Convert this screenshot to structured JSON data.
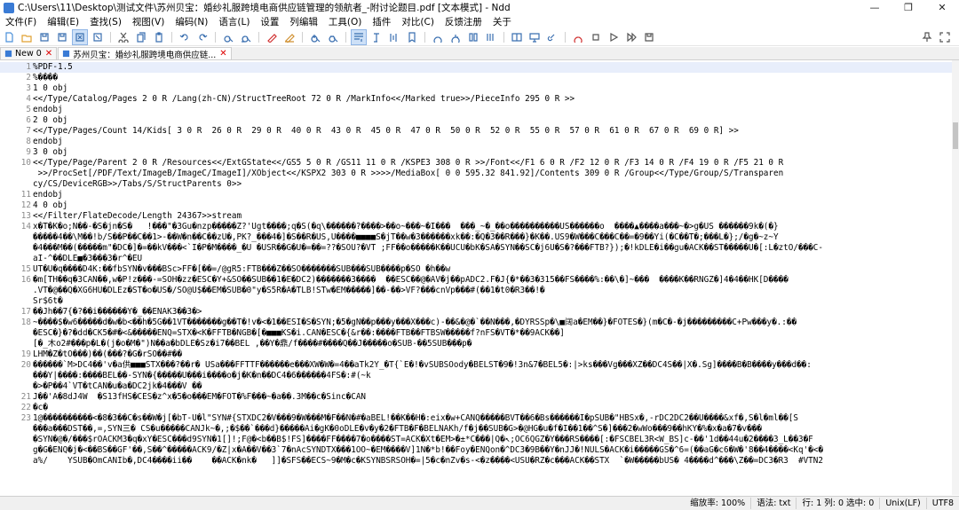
{
  "window": {
    "title": "C:\\Users\\11\\Desktop\\测试文件\\苏州贝宝：婚纱礼服跨境电商供应链管理的领航者_-附讨论题目.pdf [文本模式] - Ndd",
    "minimize_glyph": "—",
    "maximize_glyph": "❐",
    "close_glyph": "✕"
  },
  "menu": {
    "items": [
      {
        "label": "文件(F)"
      },
      {
        "label": "编辑(E)"
      },
      {
        "label": "查找(S)"
      },
      {
        "label": "视图(V)"
      },
      {
        "label": "编码(N)"
      },
      {
        "label": "语言(L)"
      },
      {
        "label": "设置"
      },
      {
        "label": "列编辑"
      },
      {
        "label": "工具(O)"
      },
      {
        "label": "插件"
      },
      {
        "label": "对比(C)"
      },
      {
        "label": "反馈注册"
      },
      {
        "label": "关于"
      }
    ]
  },
  "toolbar": {
    "icons": [
      {
        "name": "new-file-icon",
        "color": "#4a90d9"
      },
      {
        "name": "open-file-icon",
        "color": "#e0a030"
      },
      {
        "name": "save-icon",
        "color": "#3a6fb0"
      },
      {
        "name": "save-all-icon",
        "color": "#3a6fb0"
      },
      {
        "name": "close-file-icon",
        "color": "#3a6fb0"
      },
      {
        "name": "close-all-icon",
        "color": "#3a6fb0"
      },
      {
        "name": "cut-icon",
        "color": "#555555"
      },
      {
        "name": "copy-icon",
        "color": "#3a6fb0"
      },
      {
        "name": "paste-icon",
        "color": "#3a6fb0"
      },
      {
        "name": "undo-icon",
        "color": "#3a6fb0"
      },
      {
        "name": "redo-icon",
        "color": "#3a6fb0"
      },
      {
        "name": "find-icon",
        "color": "#3a6fb0"
      },
      {
        "name": "replace-icon",
        "color": "#3a6fb0"
      },
      {
        "name": "mark-icon",
        "color": "#d03030"
      },
      {
        "name": "clear-mark-icon",
        "color": "#d09030"
      },
      {
        "name": "zoom-in-icon",
        "color": "#3a6fb0"
      },
      {
        "name": "zoom-out-icon",
        "color": "#3a6fb0"
      },
      {
        "name": "word-wrap-icon",
        "color": "#3a6fb0"
      },
      {
        "name": "show-symbols-icon",
        "color": "#3a6fb0"
      },
      {
        "name": "indent-guide-icon",
        "color": "#3a6fb0"
      },
      {
        "name": "bookmark-icon",
        "color": "#3a6fb0"
      },
      {
        "name": "encoding-icon",
        "color": "#3a6fb0"
      },
      {
        "name": "sync-icon",
        "color": "#3a6fb0"
      },
      {
        "name": "compare-icon",
        "color": "#3a6fb0"
      },
      {
        "name": "column-edit-icon",
        "color": "#3a6fb0"
      },
      {
        "name": "split-view-icon",
        "color": "#3a6fb0"
      },
      {
        "name": "monitor-icon",
        "color": "#3a6fb0"
      },
      {
        "name": "link-icon",
        "color": "#3a6fb0"
      },
      {
        "name": "record-macro-icon",
        "color": "#d03030"
      },
      {
        "name": "stop-macro-icon",
        "color": "#555555"
      },
      {
        "name": "play-macro-icon",
        "color": "#555555"
      },
      {
        "name": "run-macro-icon",
        "color": "#555555"
      },
      {
        "name": "save-macro-icon",
        "color": "#555555"
      }
    ],
    "pin_icon_color": "#555555",
    "expand_icon_color": "#555555"
  },
  "tabs": [
    {
      "label": "New 0",
      "close": "✕",
      "active": false
    },
    {
      "label": "苏州贝宝：婚纱礼服跨境电商供应链...",
      "close": "✕",
      "active": true
    }
  ],
  "editor": {
    "lines": [
      {
        "n": "1",
        "text": "%PDF-1.5"
      },
      {
        "n": "2",
        "text": "%����"
      },
      {
        "n": "3",
        "text": "1 0 obj"
      },
      {
        "n": "4",
        "text": "<</Type/Catalog/Pages 2 0 R /Lang(zh-CN)/StructTreeRoot 72 0 R /MarkInfo<</Marked true>>/PieceInfo 295 0 R >>"
      },
      {
        "n": "5",
        "text": "endobj"
      },
      {
        "n": "6",
        "text": "2 0 obj"
      },
      {
        "n": "7",
        "text": "<</Type/Pages/Count 14/Kids[ 3 0 R  26 0 R  29 0 R  40 0 R  43 0 R  45 0 R  47 0 R  50 0 R  52 0 R  55 0 R  57 0 R  61 0 R  67 0 R  69 0 R] >>"
      },
      {
        "n": "8",
        "text": "endobj"
      },
      {
        "n": "9",
        "text": "3 0 obj"
      },
      {
        "n": "10",
        "text": "<</Type/Page/Parent 2 0 R /Resources<</ExtGState<</GS5 5 0 R /GS11 11 0 R /KSPE3 308 0 R >>/Font<</F1 6 0 R /F2 12 0 R /F3 14 0 R /F4 19 0 R /F5 21 0 R"
      },
      {
        "n": "",
        "text": " >>/ProcSet[/PDF/Text/ImageB/ImageC/ImageI]/XObject<</KSPX2 303 0 R >>>>/MediaBox[ 0 0 595.32 841.92]/Contents 309 0 R /Group<</Type/Group/S/Transparen"
      },
      {
        "n": "",
        "text": "cy/CS/DeviceRGB>>/Tabs/S/StructParents 0>>"
      },
      {
        "n": "11",
        "text": "endobj"
      },
      {
        "n": "12",
        "text": "4 0 obj"
      },
      {
        "n": "13",
        "text": "<</Filter/FlateDecode/Length 24367>>stream"
      },
      {
        "n": "14",
        "text": "x�T�K�o;N��-�S�jn�S�   !���\"�3Gu�nzp�����Z?'Ugt����;q�S(�q\\������?����>��o~���~�I���  ���_~�_��o����������US������o  ����▲����a���~�>g�US ������9k�(�}"
      },
      {
        "n": "",
        "text": "�����4��\\M��!b/S��P��C��1>-��W�n��C��zU�,PK?_���4�]�S��R�US,U����■■■■S�jT��w�3������xk��:�Q�3��R���}�K��.US9�W���C���C��=�9��Yi(�C��T�;���L�};/�g�~z~Y"
      },
      {
        "n": "",
        "text": "�4���M��(�����m\"�DC�]�=��kV���<`I�P�M����_�U �USR��G�U�=��=??�SOU?�VT ;FF��o�����K��UCU�bK�SA�SYN��SC�j6U�S�?���FTB?});�!kDLE�i��gu�ACK��ST�����U�[:L�ztO/���C-"
      },
      {
        "n": "",
        "text": "aI-^��DLE■�3���3�r^�EU"
      },
      {
        "n": "15",
        "text": "UT�U�q����D4K:��fbSYN�v���BSc>FF�[��=/@gR5:FTB���Z��SO�������SUB���SUB����p�SO �h��w"
      },
      {
        "n": "16",
        "text": "�m[TH��q�3CAN��,w�P!z���-=SOH�zz�ESC�Y+&SO��SUB��1�E�DC2)�������3����  ��ESC��@�AV�j��pADC2.F�J{�*��3�315��FS����%:��\\�]~���  ����K��RNGZ�]4�4��HK[D����"
      },
      {
        "n": "",
        "text": ".VT�@��Q�XG6HU�DLEz�ST�o�US�/SO@U$��EM�SUB�0\"y�S5R�A�TLB!STw�EM�����]��-��>VF?���cnVp���#(��1�t0�R3��!�"
      },
      {
        "n": "",
        "text": "Sr$6t�"
      },
      {
        "n": "17",
        "text": "��Jh��7{�?��i������Y�_��ENAK3��3�>"
      },
      {
        "n": "18",
        "text": "~����$�w6�����d�w�b<��h�5G��1VT�������g��T�!v�<�1��ESI�S�SYN;�5�gN��p���y���X���c)-��&�@�`��N���,�DYRSSp�\\■阔a�EM��}�FOTES�}(m�C�-�j���������C+Pw���y�.:��"
      },
      {
        "n": "",
        "text": "�ESC�}�?�dd�CK5�#�<&�����ENQ=STX�<K�FFTB�NGB�[�■■■KS�i.CAN�ESC�{&r��:����FTB��FTBSW�����f?nFS�VT�*��9ACK��]"
      },
      {
        "n": "",
        "text": "[�_木o2#���p�L�(j�o�M�\")N��a�bDLE�Sz�i7��BEL ,��Y�鼎/f����#����Q��J�����o�SUB-��5SUB���p�"
      },
      {
        "n": "19",
        "text": "LHM�Z�tO���)��(���?�G�rSO��#��"
      },
      {
        "n": "20",
        "text": "������`M>DC4��'v�a供■■■STX���?��r� USa���FFTTF������e���XW�W�=4��aTk2Y_�T{`E�!�vSUBSOody�BELST�9�!3n&7�BEL5�:|>ks���Vg���XZ��DC4S��|X�.Sg]����B�B����y���d��:"
      },
      {
        "n": "",
        "text": "���Y|����:����BEL��-SYN�{�����U���i����o�j�K�n��DC4�6������4FS�:#(~k"
      },
      {
        "n": "",
        "text": "�>�P��4`VT�tCAN�u�a�DC2jk�4���V ��"
      },
      {
        "n": "21",
        "text": "J��'A�8dJ4W  �S13fHS�CES�z^x�5�o���EM�FOT�%F���~�a��.3M��c�Sinc�CAN"
      },
      {
        "n": "22",
        "text": "�c�"
      },
      {
        "n": "23",
        "text": "1@����������<�8�3��C�s��W�j[�bT-U�l\"SYN#{STXDC2�V���9�W���M�F��N�#�aBEL!��K��H�:eix�w+CANQ�����BVT��6�Bs������I�pSUB�\"HBSx�,-rDC2DC2��U����&xf�,S�l�ml��[S"
      },
      {
        "n": "",
        "text": "���a���DST��,=,SYN三� CS�u�����CANJk~�,;�$��`���d}�����Ai�gK�0oDLE�v�y�2�FTB�F�BELNAKh/f�j��SUB�G>�@HG�u�f�I��1��^S�]���2�wWo���9��hKY�%�x�a�7�v���"
      },
      {
        "n": "",
        "text": "�SYN�@�/���$rOACKM3�q�xY�ESC���d9SYN�1[]!;F@�<b��B$!FS]����FF����7�o����ST=ACK�Xt�EM>�±*C���|Q�↖;OC6QGZ�Y���RS����[:�FSCBEL3R<W_BS]c-��'1d��44u�2����3_L��3�F"
      },
      {
        "n": "",
        "text": "g�G�ENQ�j�<��BS��GF'��,S��^�����ACK9/�Z|x�A��V��3`7�nAcSYNDTX���1OO~�EM����V]1N�*b!��Foy�ENQon�^DC3�9B��Y�nJJ�!NULS�ACK�i�����GS�^6=(��aG�c6�W�'8��4����<Kq'�<�"
      },
      {
        "n": "",
        "text": "a%/    YSUB�OmCANIb�,DC4����ii��    ��ACK�nk�   ]]�SFS��ECS~9�M�c�KSYNBSRSOH�=|5�c�nZv�s-<�z����<USU�RZ�c���ACK��STX  `�W�����bUS� 4����d^���\\Z��=DC3�R3  #VTN2"
      }
    ]
  },
  "status": {
    "zoom": "缩放率: 100%",
    "lang": "语法: txt",
    "pos": "行: 1 列: 0 选中: 0",
    "eol": "Unix(LF)",
    "encoding": "UTF8"
  }
}
